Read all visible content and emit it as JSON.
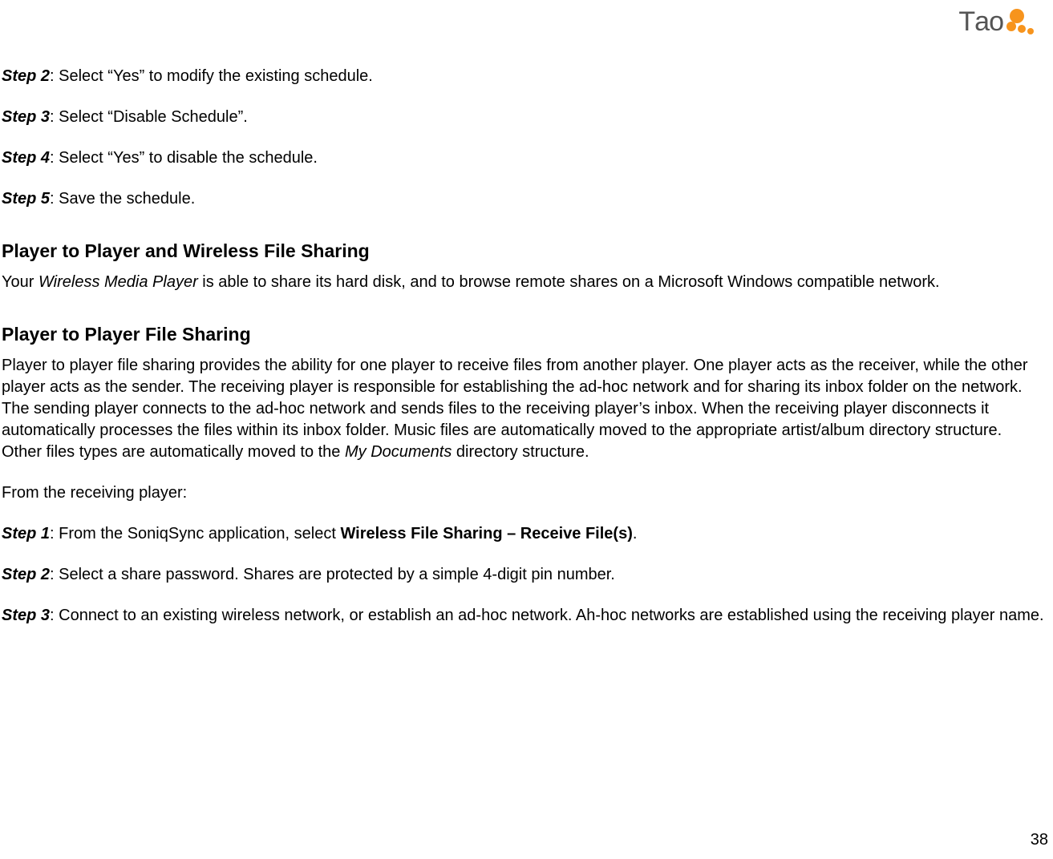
{
  "logo": {
    "text": "Tao"
  },
  "steps_top": [
    {
      "label": "Step 2",
      "text": ": Select “Yes” to modify the existing schedule."
    },
    {
      "label": "Step 3",
      "text": ": Select “Disable Schedule”."
    },
    {
      "label": "Step 4",
      "text": ": Select “Yes” to disable the schedule."
    },
    {
      "label": "Step 5",
      "text": ": Save the schedule."
    }
  ],
  "section1": {
    "heading": "Player to Player and Wireless File Sharing",
    "para_pre": "Your ",
    "para_italic": "Wireless Media Player",
    "para_post": " is able to share its hard disk, and to browse remote shares on a Microsoft Windows compatible network."
  },
  "section2": {
    "heading": "Player to Player File Sharing",
    "para1_pre": "Player to player file sharing provides the ability for one player to receive files from another player.  One player acts as the receiver, while the other player acts as the sender.  The receiving player is responsible for establishing the ad-hoc network and for sharing its inbox folder on the network.  The sending player connects to the ad-hoc network and sends files to the receiving player’s inbox.  When the receiving player disconnects it automatically processes the files within its inbox folder.  Music files are automatically moved to the appropriate artist/album directory structure.  Other files types are automatically moved to the ",
    "para1_italic": "My Documents",
    "para1_post": " directory structure.",
    "subhead": "From the receiving player:",
    "step1": {
      "label": "Step 1",
      "pre": ": From the SoniqSync application, select ",
      "bold": "Wireless File Sharing – Receive File(s)",
      "post": "."
    },
    "step2": {
      "label": "Step 2",
      "text": ": Select a share password.  Shares are protected by a simple 4-digit pin number."
    },
    "step3": {
      "label": "Step 3",
      "text": ": Connect to an existing wireless network, or establish an ad-hoc network. Ah-hoc networks are established using the receiving player name."
    }
  },
  "page_number": "38"
}
